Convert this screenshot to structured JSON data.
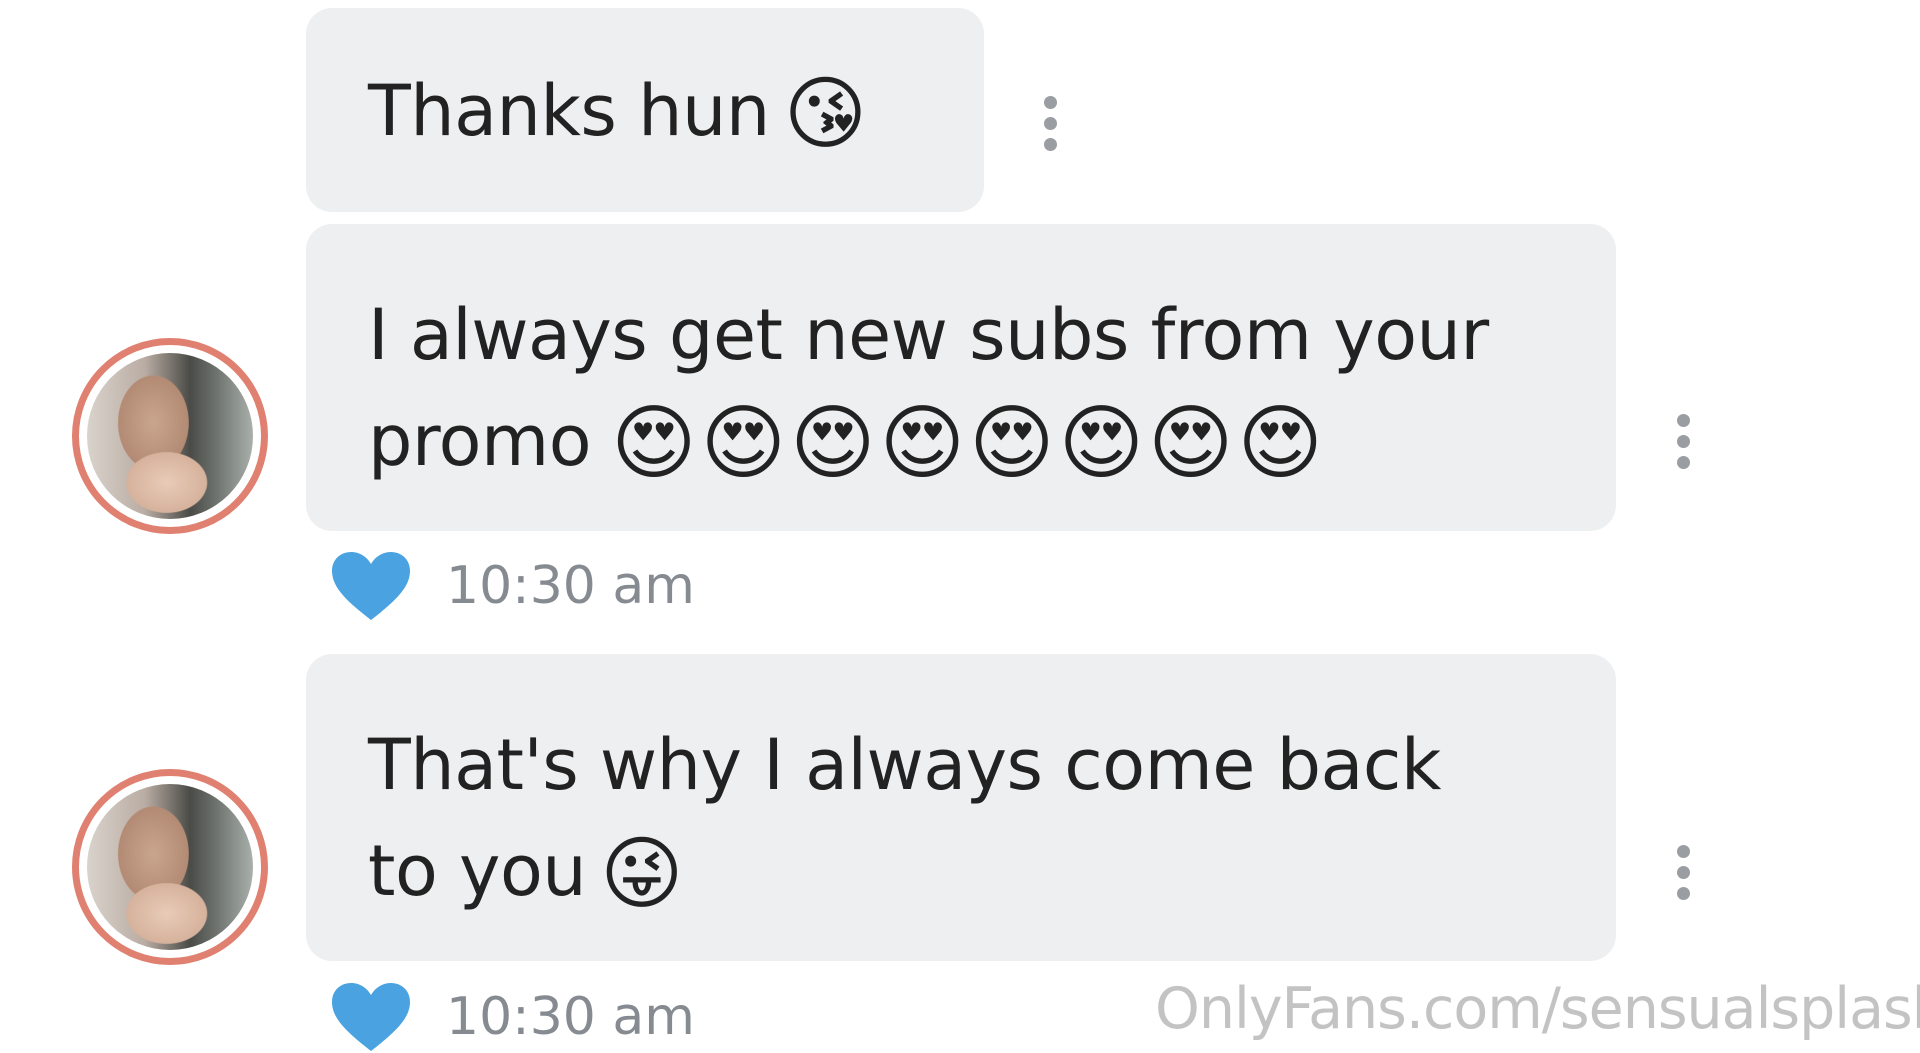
{
  "messages": [
    {
      "text_lines": [
        "Thanks hun"
      ],
      "emoji": "😘"
    },
    {
      "text_lines": [
        "I always get new subs from your",
        "promo"
      ],
      "emoji": "😍😍😍😍😍😍😍😍",
      "time": "10:30 am",
      "liked": true
    },
    {
      "text_lines": [
        "That's why I always come back",
        "to you"
      ],
      "emoji": "😜",
      "time": "10:30 am",
      "liked": true
    }
  ],
  "watermark": "OnlyFans.com/sensualsplash",
  "icons": {
    "like": "heart-icon",
    "menu": "more-vertical-icon"
  },
  "colors": {
    "bubble_bg": "#eeeff0",
    "heart": "#4aa3e0",
    "avatar_ring": "#e08070",
    "timestamp": "#868b91"
  }
}
